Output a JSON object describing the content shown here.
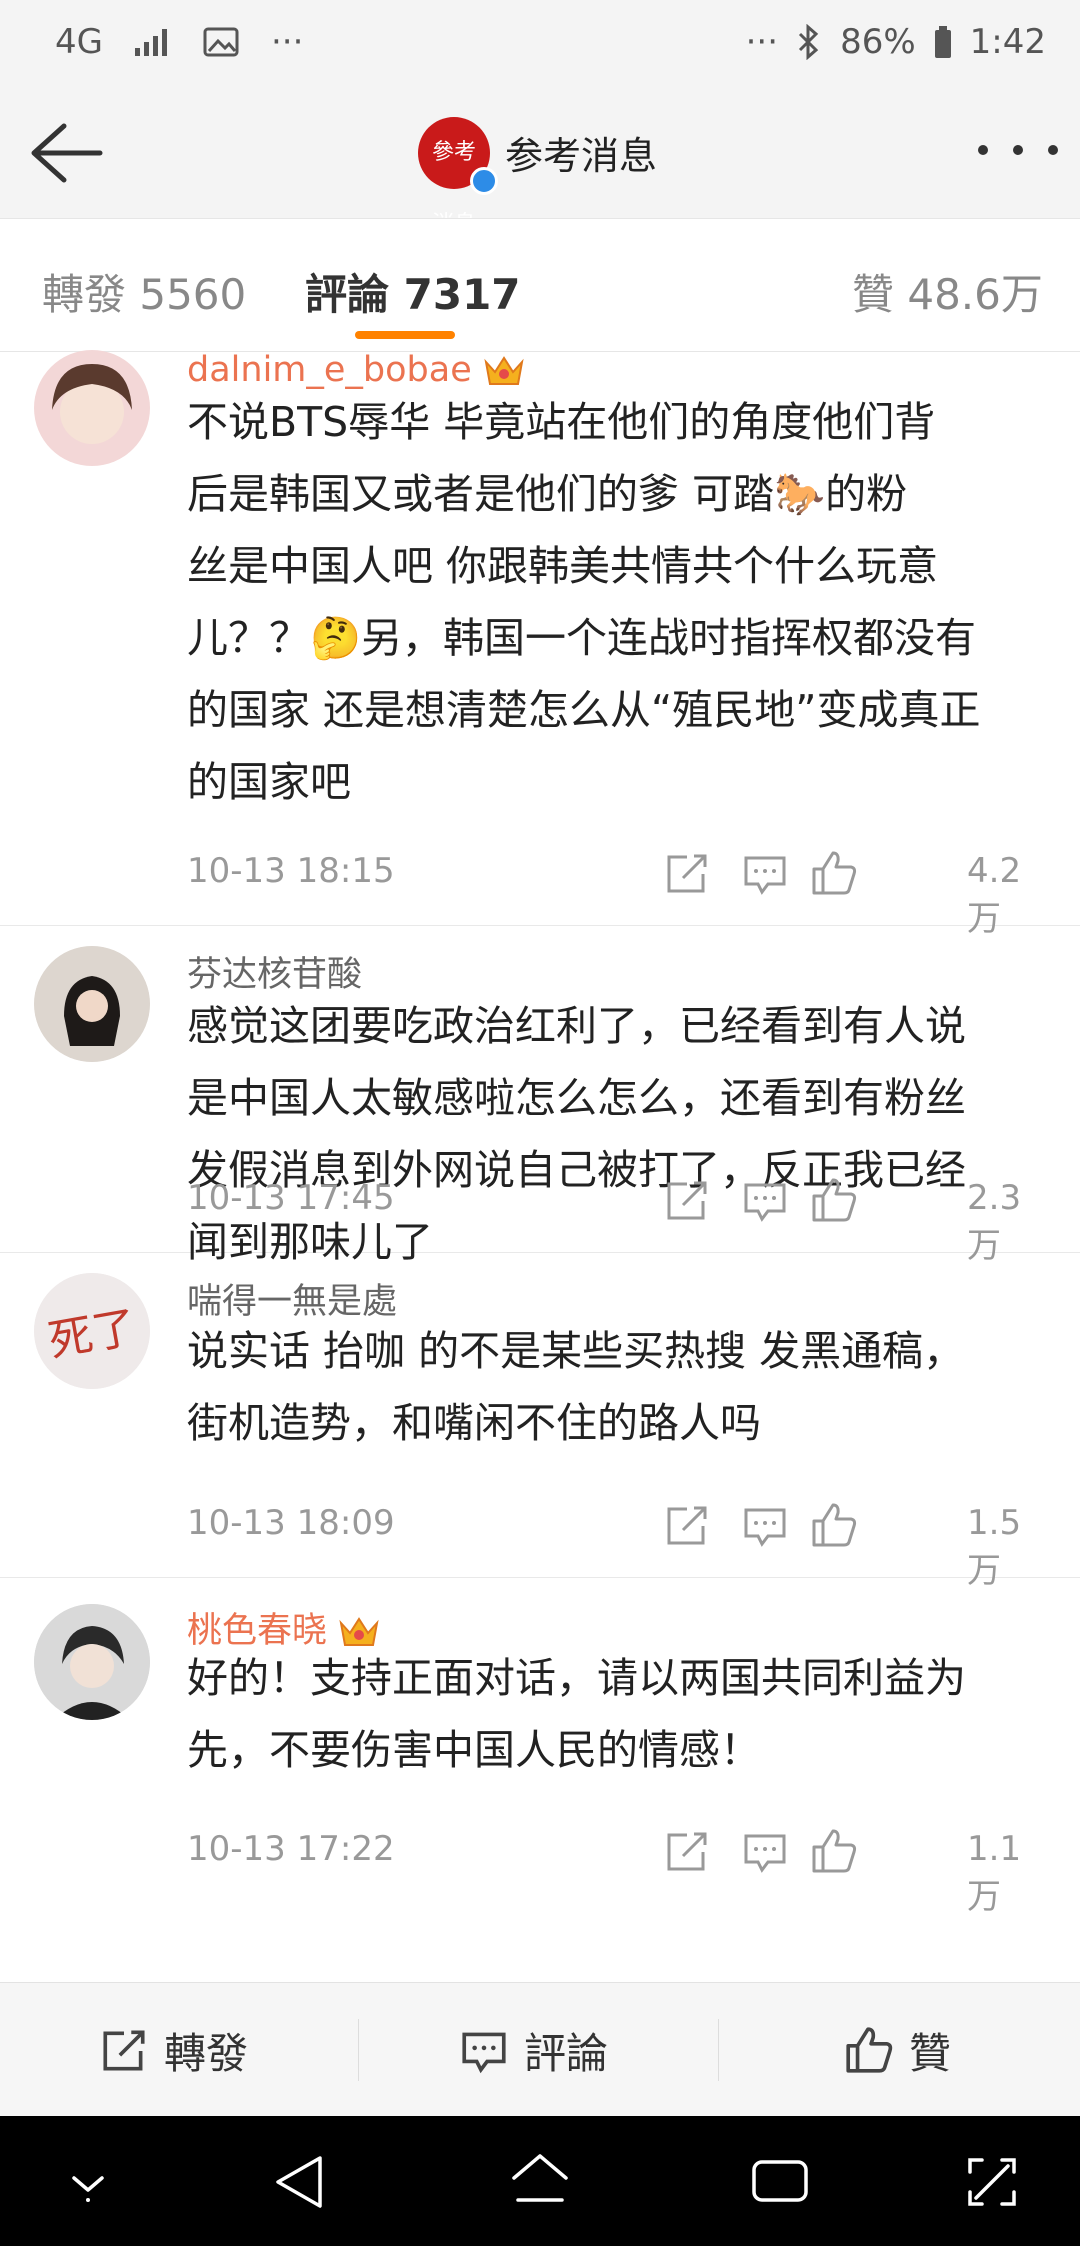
{
  "status": {
    "network": "4G",
    "battery": "86%",
    "time": "1:42",
    "more": "···"
  },
  "header": {
    "title": "参考消息",
    "logo_text": "參考 消息"
  },
  "tabs": [
    {
      "label": "轉發 5560"
    },
    {
      "label": "評論 7317"
    },
    {
      "label": "贊 48.6万"
    }
  ],
  "comments": [
    {
      "user": "dalnim_e_bobae",
      "vip": true,
      "text": "不说BTS辱华 毕竟站在他们的角度他们背\n后是韩国又或者是他们的爹 可踏🐎的粉\n丝是中国人吧 你跟韩美共情共个什么玩意\n儿？？🤔另，韩国一个连战时指挥权都没有\n的国家 还是想清楚怎么从“殖民地”变成真正\n的国家吧",
      "time": "10-13 18:15",
      "likes": "4.2万"
    },
    {
      "user": "芬达核苷酸",
      "vip": false,
      "text": "感觉这团要吃政治红利了，已经看到有人说\n是中国人太敏感啦怎么怎么，还看到有粉丝\n发假消息到外网说自己被打了，反正我已经\n闻到那味儿了",
      "time": "10-13 17:45",
      "likes": "2.3万"
    },
    {
      "user": "喘得一無是處",
      "vip": false,
      "text": "说实话 抬咖 的不是某些买热搜 发黑通稿，\n街机造势，和嘴闲不住的路人吗",
      "time": "10-13 18:09",
      "likes": "1.5万"
    },
    {
      "user": "桃色春晓",
      "vip": true,
      "text": "好的！支持正面对话，请以两国共同利益为\n先，不要伤害中国人民的情感！",
      "time": "10-13 17:22",
      "likes": "1.1万"
    }
  ],
  "bottom": {
    "repost": "轉發",
    "comment": "評論",
    "like": "贊"
  },
  "colors": {
    "accent": "#ff8200",
    "vip_name": "#eb7350"
  }
}
